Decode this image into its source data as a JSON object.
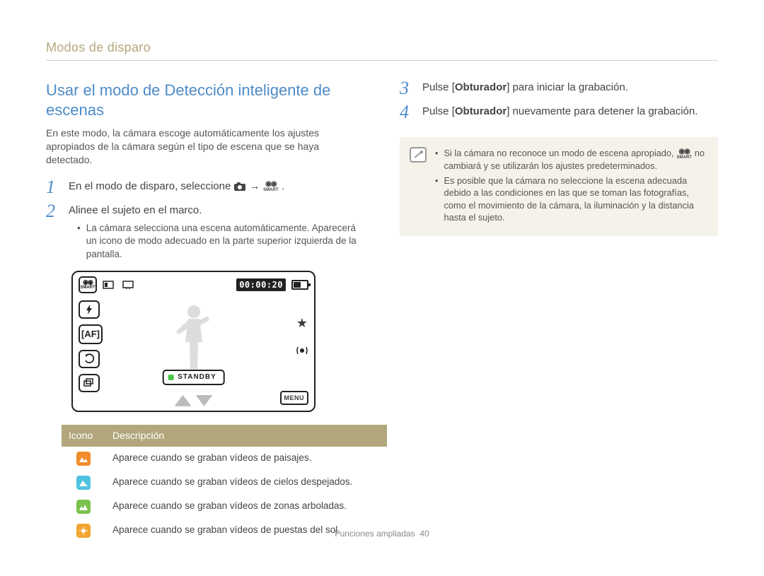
{
  "header": {
    "section": "Modos de disparo"
  },
  "main": {
    "heading": "Usar el modo de Detección inteligente de escenas",
    "intro": "En este modo, la cámara escoge automáticamente los ajustes apropiados de la cámara según el tipo de escena que se haya detectado."
  },
  "steps": {
    "s1_num": "1",
    "s1_text_a": "En el modo de disparo, seleccione ",
    "s1_text_b": " → ",
    "s1_text_c": ".",
    "s2_num": "2",
    "s2_text": "Alinee el sujeto en el marco.",
    "s2_bullet": "La cámara selecciona una escena automáticamente. Aparecerá un icono de modo adecuado en la parte superior izquierda de la pantalla.",
    "s3_num": "3",
    "s3_pre": "Pulse [",
    "s3_bold": "Obturador",
    "s3_post": "] para iniciar la grabación.",
    "s4_num": "4",
    "s4_pre": "Pulse [",
    "s4_bold": "Obturador",
    "s4_post": "] nuevamente para detener la grabación."
  },
  "camera": {
    "smart_label": "SMART",
    "time": "00:00:20",
    "standby": "STANDBY",
    "btn_af": "AF",
    "menu": "MENU"
  },
  "table": {
    "col_icon": "Icono",
    "col_desc": "Descripción",
    "rows": [
      {
        "desc": "Aparece cuando se graban vídeos de paisajes."
      },
      {
        "desc": "Aparece cuando se graban vídeos de cielos despejados."
      },
      {
        "desc": "Aparece cuando se graban vídeos de zonas arboladas."
      },
      {
        "desc": "Aparece cuando se graban vídeos de puestas del sol."
      }
    ]
  },
  "notes": {
    "n1_a": "Si la cámara no reconoce un modo de escena apropiado, ",
    "n1_b": " no cambiará y se utilizarán los ajustes predeterminados.",
    "n2": "Es posible que la cámara no seleccione la escena adecuada debido a las condiciones en las que se toman las fotografías, como el movimiento de la cámara, la iluminación y la distancia hasta el sujeto."
  },
  "footer": {
    "section": "Funciones ampliadas",
    "page": "40"
  }
}
